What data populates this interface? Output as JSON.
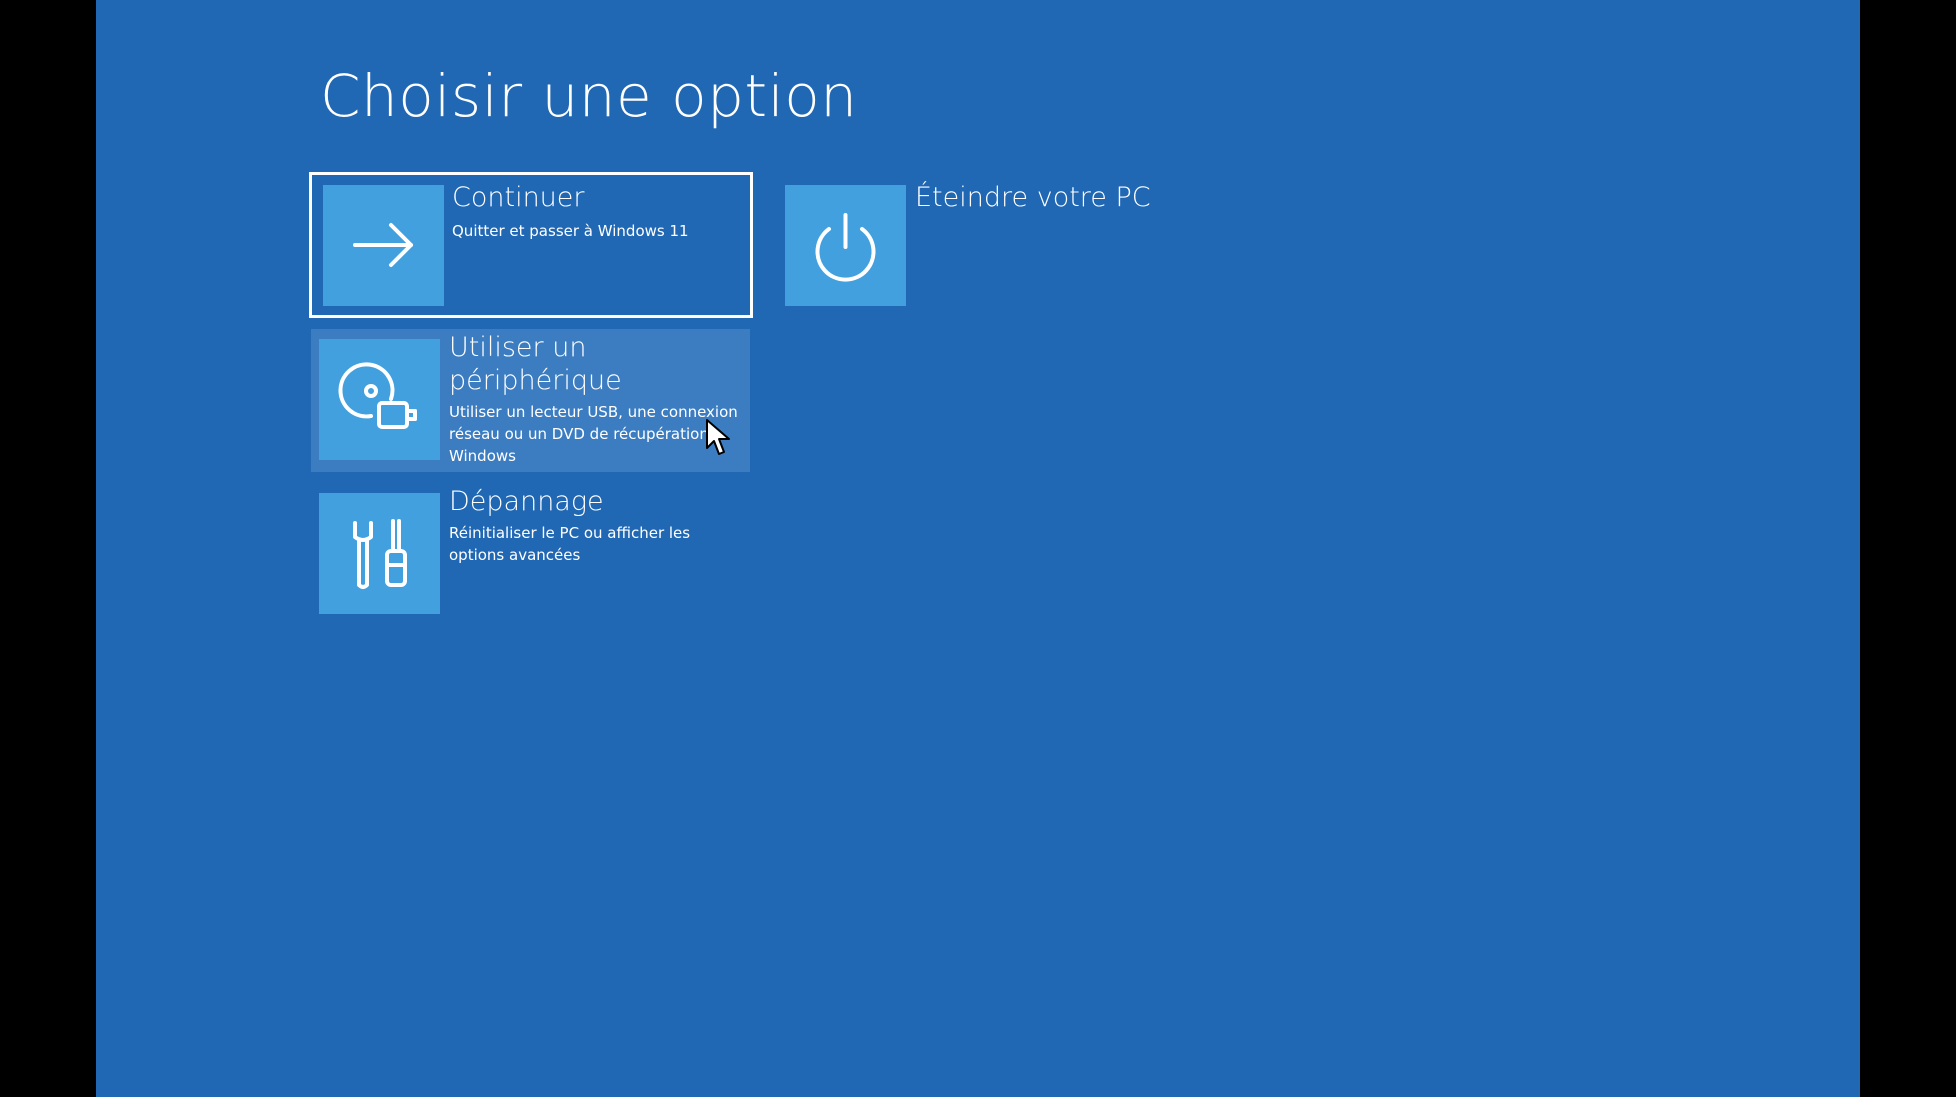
{
  "page": {
    "title": "Choisir une option"
  },
  "options": [
    {
      "id": "continue",
      "title": "Continuer",
      "description": "Quitter et passer à Windows 11",
      "icon": "arrow-right-icon",
      "state": "focused"
    },
    {
      "id": "shutdown",
      "title": "Éteindre votre PC",
      "description": "",
      "icon": "power-icon",
      "state": "normal"
    },
    {
      "id": "use-device",
      "title": "Utiliser un périphérique",
      "description": "Utiliser un lecteur USB, une connexion réseau ou un DVD de récupération Windows",
      "icon": "device-disc-usb-icon",
      "state": "hovered"
    },
    {
      "id": "troubleshoot",
      "title": "Dépannage",
      "description": "Réinitialiser le PC ou afficher les options avancées",
      "icon": "tools-icon",
      "state": "normal"
    }
  ],
  "colors": {
    "background": "#2067b4",
    "tile_icon_bg": "#43a0de",
    "hover_bg": "#3c7dc2",
    "text": "#ffffff",
    "letterbox": "#000000"
  }
}
